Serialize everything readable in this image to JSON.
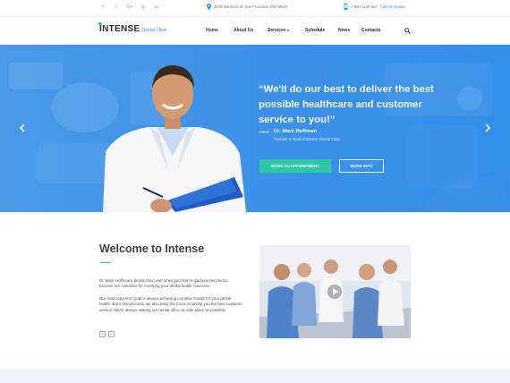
{
  "topbar": {
    "socials": [
      {
        "label": "f",
        "icon": "facebook-icon"
      },
      {
        "label": "t",
        "icon": "twitter-icon"
      },
      {
        "label": "G+",
        "icon": "google-plus-icon"
      },
      {
        "label": "◎",
        "icon": "instagram-icon"
      },
      {
        "label": "in",
        "icon": "linkedin-icon"
      }
    ],
    "address": "4578 Marmora St, San Francisco D04 89GR",
    "phone": "1-800-1234-567",
    "call_link": "Call me please!"
  },
  "brand": {
    "name": "INTENSE",
    "sub": "Dental Clinic"
  },
  "nav": {
    "items": [
      "Home",
      "About Us",
      "Services",
      "Schedule",
      "News",
      "Contacts"
    ]
  },
  "hero": {
    "quote": "“We'll do our best to deliver the best possible healthcare and customer service to you!”",
    "author": "Dr. Mark Hoffman",
    "role": "Founder & head of Intense Dental Clinic",
    "btn_appointment": "BOOK AN APPOINTMENT",
    "btn_more": "MORE INFO"
  },
  "welcome": {
    "title": "Welcome to Intense",
    "para1": "Dr. Mark Hoffman's dental clinic welcomes you! We're glad you decided to become our customer for resolving your dental health concerns.",
    "para2": "Our main long-term goal is always achieving complex results for your dental health. But in the process, we also keep the focus on giving you the best customer service. We're always making our dental office as safe place as possible!",
    "pager_prev": "‹",
    "pager_next": "›"
  },
  "colors": {
    "accent": "#2f8fe8",
    "teal": "#2ec7a6",
    "hero": "#3a8fe8"
  }
}
